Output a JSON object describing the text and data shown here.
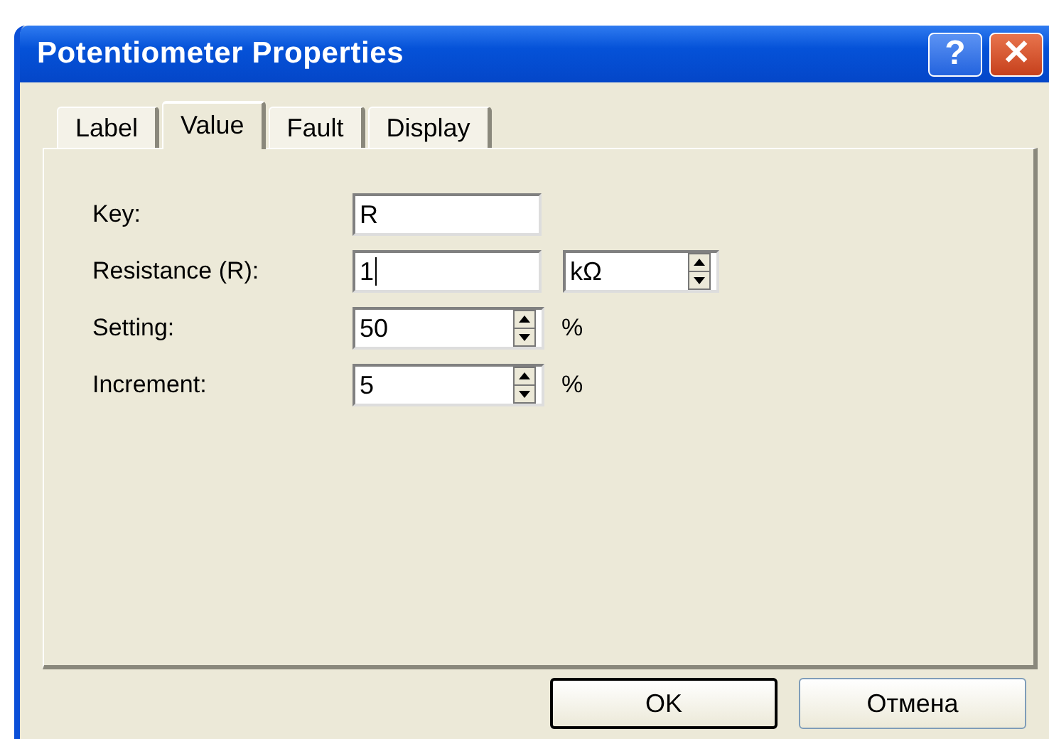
{
  "window": {
    "title": "Potentiometer Properties"
  },
  "title_buttons": [
    {
      "kind": "help",
      "label": "?"
    },
    {
      "kind": "close",
      "label": "✕"
    }
  ],
  "tabs": [
    {
      "label": "Label",
      "selected": false
    },
    {
      "label": "Value",
      "selected": true
    },
    {
      "label": "Fault",
      "selected": false
    },
    {
      "label": "Display",
      "selected": false
    }
  ],
  "fields": [
    {
      "label": "Key:",
      "kind": "text",
      "value": "R",
      "focused": false
    },
    {
      "label": "Resistance (R):",
      "kind": "text",
      "value": "1",
      "focused": true,
      "unit_dropdown": "kΩ"
    },
    {
      "label": "Setting:",
      "kind": "spin",
      "value": "50",
      "focused": false,
      "suffix": "%"
    },
    {
      "label": "Increment:",
      "kind": "spin",
      "value": "5",
      "focused": false,
      "suffix": "%"
    }
  ],
  "buttons": [
    {
      "label": "OK",
      "default": true
    },
    {
      "label": "Отмена",
      "default": false
    }
  ]
}
